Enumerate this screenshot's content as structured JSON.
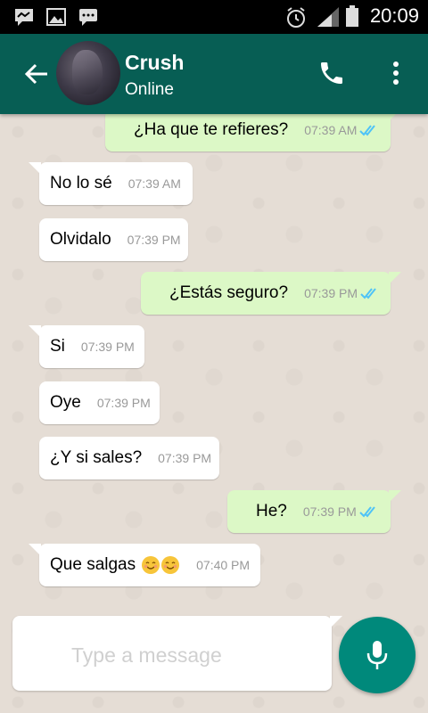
{
  "status_bar": {
    "time": "20:09",
    "icons": [
      "message-icon",
      "image-icon",
      "chat-icon",
      "alarm-icon",
      "signal-icon",
      "battery-icon"
    ]
  },
  "header": {
    "contact_name": "Crush",
    "contact_status": "Online",
    "icons": [
      "back-arrow-icon",
      "avatar",
      "call-icon",
      "more-vert-icon"
    ]
  },
  "messages": [
    {
      "direction": "outgoing",
      "text": "¿Ha que te refieres?",
      "time": "07:39 AM",
      "read": true
    },
    {
      "direction": "incoming",
      "text": "No lo sé",
      "time": "07:39 AM"
    },
    {
      "direction": "incoming",
      "text": "Olvidalo",
      "time": "07:39 PM"
    },
    {
      "direction": "outgoing",
      "text": "¿Estás seguro?",
      "time": "07:39 PM",
      "read": true
    },
    {
      "direction": "incoming",
      "text": "Si",
      "time": "07:39 PM"
    },
    {
      "direction": "incoming",
      "text": "Oye",
      "time": "07:39 PM"
    },
    {
      "direction": "incoming",
      "text": "¿Y si sales?",
      "time": "07:39 PM"
    },
    {
      "direction": "outgoing",
      "text": "He?",
      "time": "07:39 PM",
      "read": true
    },
    {
      "direction": "incoming",
      "text": "Que salgas",
      "emoji": [
        "blush-emoji",
        "blush-emoji"
      ],
      "time": "07:40 PM"
    }
  ],
  "composer": {
    "placeholder": "Type a message",
    "mic_icon": "mic-icon"
  },
  "colors": {
    "header": "#075e54",
    "outgoing_bubble": "#dcf8c6",
    "incoming_bubble": "#ffffff",
    "chat_background": "#e5ddd5",
    "mic_button": "#00897b",
    "read_ticks": "#4fc3f7"
  }
}
